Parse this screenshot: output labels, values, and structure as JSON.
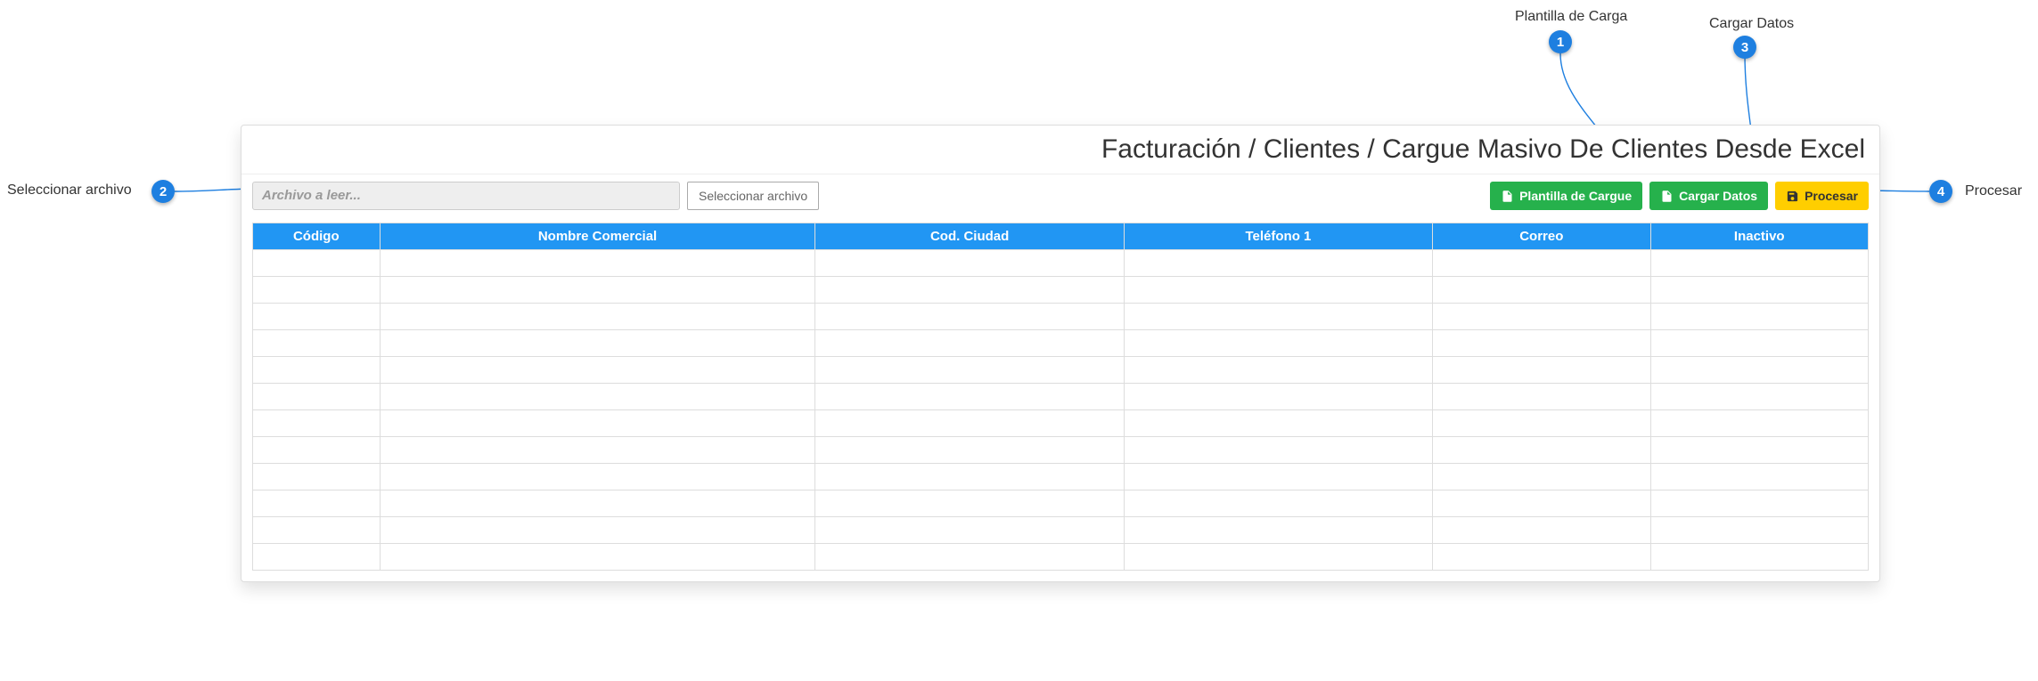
{
  "breadcrumb": "Facturación / Clientes / Cargue Masivo De Clientes Desde Excel",
  "fileInput": {
    "placeholder": "Archivo a leer...",
    "selectLabel": "Seleccionar archivo"
  },
  "buttons": {
    "plantilla": "Plantilla de Cargue",
    "cargar": "Cargar Datos",
    "procesar": "Procesar"
  },
  "table": {
    "headers": {
      "codigo": "Código",
      "nombre": "Nombre Comercial",
      "ciudad": "Cod. Ciudad",
      "telefono": "Teléfono 1",
      "correo": "Correo",
      "inactivo": "Inactivo"
    },
    "emptyRows": 12
  },
  "annotations": {
    "a1": {
      "num": "1",
      "label": "Plantilla de Carga"
    },
    "a2": {
      "num": "2",
      "label": "Seleccionar archivo"
    },
    "a3": {
      "num": "3",
      "label": "Cargar Datos"
    },
    "a4": {
      "num": "4",
      "label": "Procesar"
    }
  }
}
